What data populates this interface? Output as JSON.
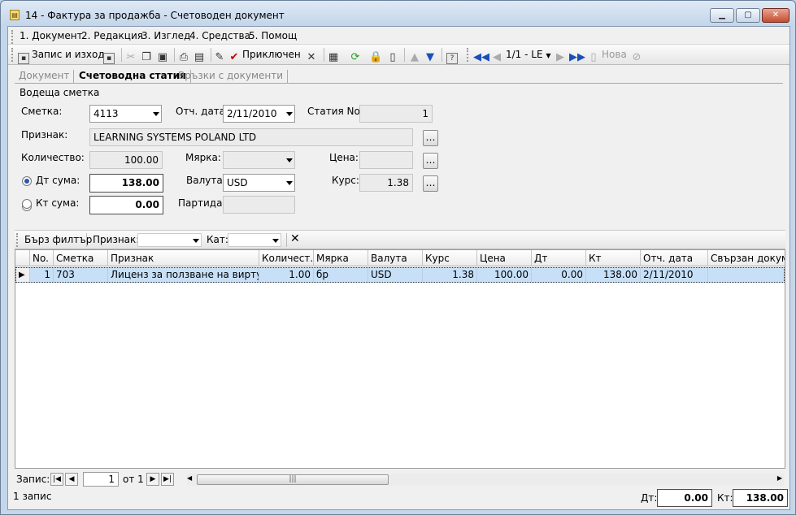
{
  "window": {
    "title": "14 - Фактура за продажба - Счетоводен документ"
  },
  "menu": [
    "1. Документ",
    "2. Редакция",
    "3. Изглед",
    "4. Средства",
    "5. Помощ"
  ],
  "toolbar": {
    "save_exit": "Запис и изход",
    "finish": "Приключен",
    "record_nav": "1/1 - LE",
    "new": "Нова"
  },
  "tabs": [
    "Документ",
    "Счетоводна статия",
    "Връзки с документи"
  ],
  "form": {
    "group_label": "Водеща сметка",
    "account_label": "Сметка:",
    "account_value": "4113",
    "date_label": "Отч. дата:",
    "date_value": "2/11/2010",
    "article_label": "Статия No.",
    "article_value": "1",
    "attribute_label": "Признак:",
    "attribute_value": "LEARNING SYSTEMS POLAND LTD",
    "quantity_label": "Количество:",
    "quantity_value": "100.00",
    "measure_label": "Мярка:",
    "measure_value": "",
    "price_label": "Цена:",
    "price_value": "",
    "dt_label": "Дт сума:",
    "dt_value": "138.00",
    "currency_label": "Валута:",
    "currency_value": "USD",
    "rate_label": "Курс:",
    "rate_value": "1.38",
    "kt_label": "Кт сума:",
    "kt_value": "0.00",
    "batch_label": "Партида:",
    "batch_value": ""
  },
  "filter": {
    "quick": "Бърз филтър",
    "attribute": "Признак:",
    "category": "Кат:"
  },
  "grid": {
    "columns": [
      "No.",
      "Сметка",
      "Признак",
      "Количест...",
      "Мярка",
      "Валута",
      "Курс",
      "Цена",
      "Дт",
      "Кт",
      "Отч. дата",
      "Свързан докумен"
    ],
    "rows": [
      [
        "1",
        "703",
        "Лиценз за ползване на виртуал...",
        "1.00",
        "бр",
        "USD",
        "1.38",
        "100.00",
        "0.00",
        "138.00",
        "2/11/2010",
        ""
      ]
    ]
  },
  "nav": {
    "record_label": "Запис:",
    "current": "1",
    "of": "от 1"
  },
  "status": {
    "records": "1 запис",
    "dt_label": "Дт:",
    "dt_total": "0.00",
    "kt_label": "Кт:",
    "kt_total": "138.00"
  }
}
